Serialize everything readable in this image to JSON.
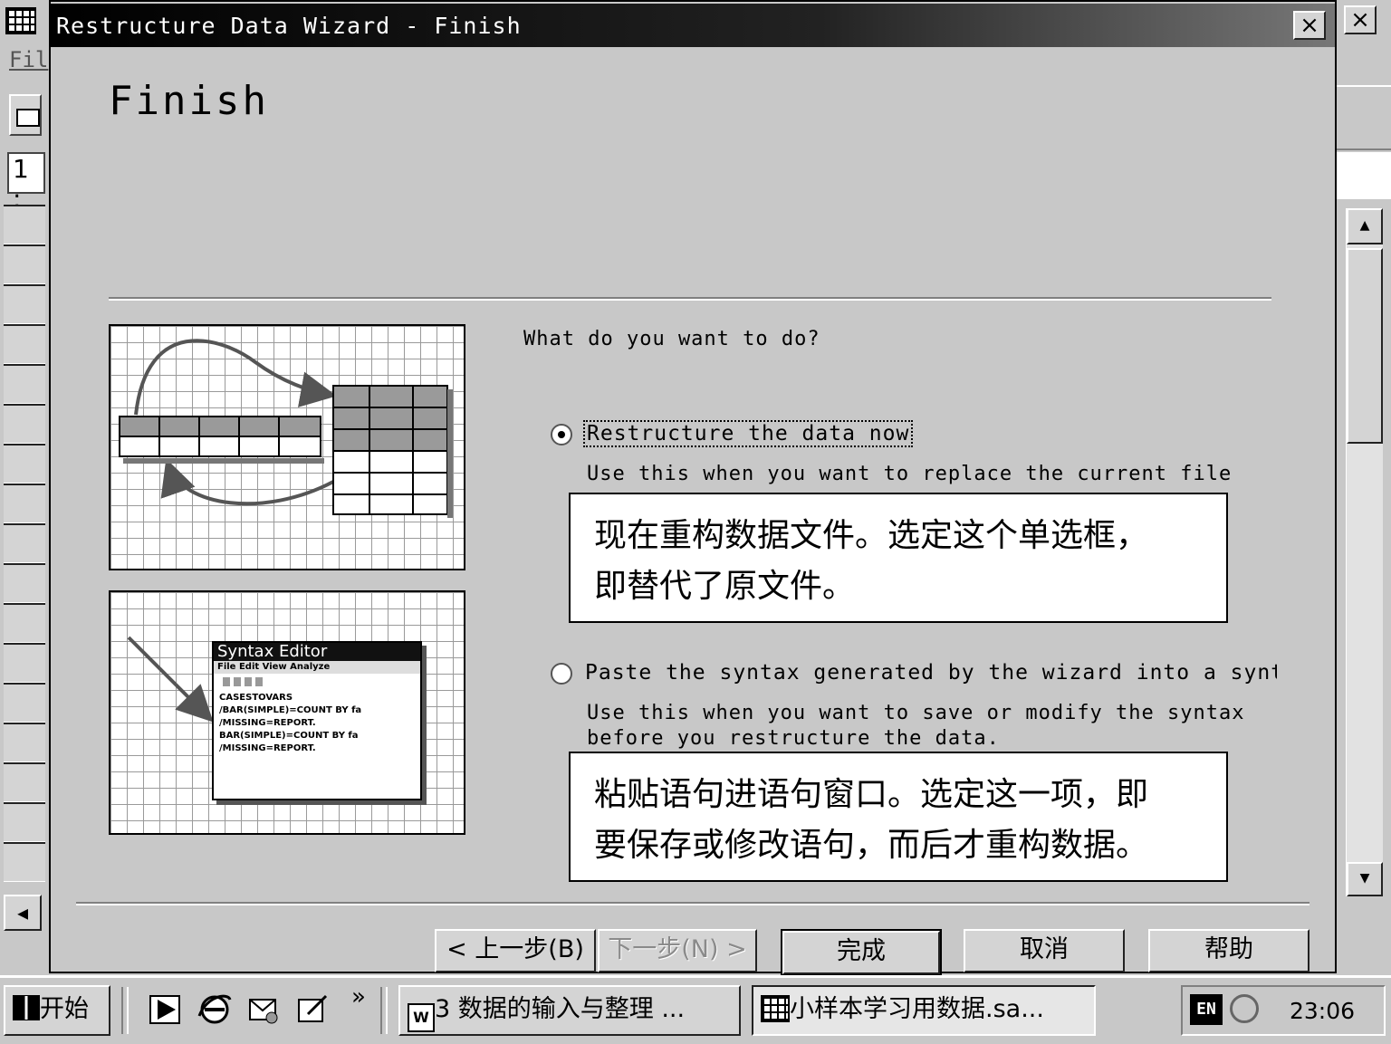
{
  "background_app": {
    "menu_fragment": "Fil",
    "cell_ref_fragment": "1 :"
  },
  "dialog": {
    "title": "Restructure Data Wizard - Finish",
    "close_glyph": "×",
    "page_title": "Finish",
    "question": "What do you want to do?",
    "options": [
      {
        "label": "Restructure the data now",
        "description": "Use this when you want to replace the current file",
        "selected": true,
        "callout_lines": [
          "现在重构数据文件。选定这个单选框，",
          "即替代了原文件。"
        ]
      },
      {
        "label": "Paste the syntax generated by the wizard into a synta:",
        "description_lines": [
          "Use this when you want to save or modify the syntax",
          "before you restructure the data."
        ],
        "selected": false,
        "callout_lines": [
          "粘贴语句进语句窗口。选定这一项，即",
          "要保存或修改语句，而后才重构数据。"
        ]
      }
    ],
    "illustration_syntax": {
      "title": "Syntax Editor",
      "menu": "File Edit View Analyze",
      "lines": [
        "CASESTOVARS",
        " /BAR(SIMPLE)=COUNT BY fa",
        " /MISSING=REPORT.",
        "BAR(SIMPLE)=COUNT BY fa",
        " /MISSING=REPORT."
      ]
    },
    "buttons": {
      "back": "< 上一步(B)",
      "next": "下一步(N) >",
      "finish": "完成",
      "cancel": "取消",
      "help": "帮助"
    }
  },
  "taskbar": {
    "start": "开始",
    "quick_launch_more": "»",
    "tasks": [
      "3 数据的输入与整理 ...",
      "小样本学习用数据.sa..."
    ],
    "tray": {
      "lang": "EN",
      "time": "23:06"
    }
  }
}
